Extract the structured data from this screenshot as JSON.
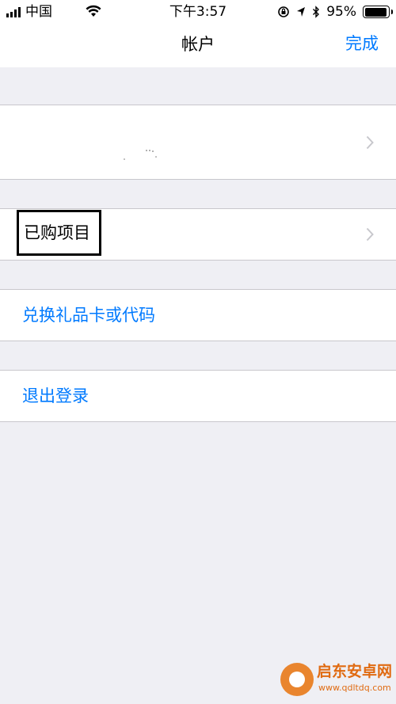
{
  "status_bar": {
    "carrier": "中国",
    "time": "下午3:57",
    "battery_percent": "95%",
    "battery_level": 0.95
  },
  "nav": {
    "title": "帐户",
    "done_label": "完成"
  },
  "rows": {
    "purchased_label": "已购项目",
    "redeem_label": "兑换礼品卡或代码",
    "signout_label": "退出登录"
  },
  "watermark": {
    "name": "启东安卓网",
    "url": "www.qdltdq.com"
  },
  "colors": {
    "accent": "#007aff",
    "background": "#efeff4",
    "watermark": "#e06b12"
  },
  "icons": {
    "signal": "signal-bars-icon",
    "wifi": "wifi-icon",
    "orientation_lock": "orientation-lock-icon",
    "location": "location-arrow-icon",
    "bluetooth": "bluetooth-icon",
    "battery": "battery-icon",
    "chevron": "chevron-right-icon"
  }
}
